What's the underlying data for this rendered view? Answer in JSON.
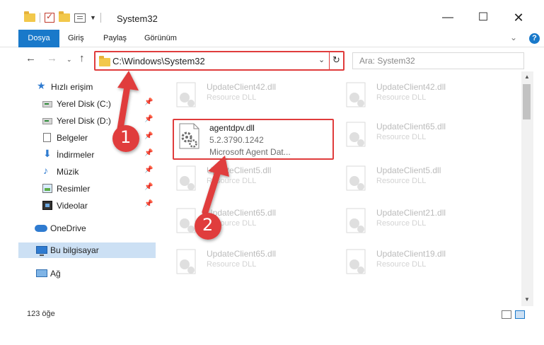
{
  "window": {
    "title": "System32",
    "minimize_icon": "minimize-icon",
    "maximize_icon": "maximize-icon",
    "close_icon": "close-icon"
  },
  "ribbon": {
    "tabs": [
      {
        "label": "Dosya",
        "active": true
      },
      {
        "label": "Giriş"
      },
      {
        "label": "Paylaş"
      },
      {
        "label": "Görünüm"
      }
    ],
    "accent": "#1979ca"
  },
  "nav": {
    "address": "C:\\Windows\\System32",
    "search_placeholder": "Ara: System32"
  },
  "sidebar": {
    "items": [
      {
        "label": "Hızlı erişim",
        "icon": "star-icon"
      },
      {
        "label": "Yerel Disk (C:)",
        "icon": "drive-icon",
        "pinned": true
      },
      {
        "label": "Yerel Disk (D:)",
        "icon": "drive-icon",
        "pinned": true
      },
      {
        "label": "Belgeler",
        "icon": "documents-icon",
        "pinned": true
      },
      {
        "label": "İndirmeler",
        "icon": "download-icon",
        "pinned": true
      },
      {
        "label": "Müzik",
        "icon": "music-icon",
        "pinned": true
      },
      {
        "label": "Resimler",
        "icon": "pictures-icon",
        "pinned": true
      },
      {
        "label": "Videolar",
        "icon": "videos-icon",
        "pinned": true
      },
      {
        "label": "OneDrive",
        "icon": "cloud-icon"
      },
      {
        "label": "Bu bilgisayar",
        "icon": "computer-icon",
        "selected": true
      },
      {
        "label": "Ağ",
        "icon": "network-icon"
      }
    ]
  },
  "files": {
    "highlighted": {
      "name": "agentdpv.dll",
      "version": "5.2.3790.1242",
      "description": "Microsoft Agent Dat..."
    },
    "background": [
      {
        "name": "UpdateClient42.dll",
        "type": "Resource DLL"
      },
      {
        "name": "UpdateClient42.dll",
        "type": "Resource DLL"
      },
      {
        "name": "UpdateClient65.dll",
        "type": "Resource DLL"
      },
      {
        "name": "UpdateClient5.dll",
        "type": "Resource DLL"
      },
      {
        "name": "UpdateClient5.dll",
        "type": "Resource DLL"
      },
      {
        "name": "UpdateClient65.dll",
        "type": "Resource DLL"
      },
      {
        "name": "UpdateClient21.dll",
        "type": "Resource DLL"
      },
      {
        "name": "UpdateClient65.dll",
        "type": "Resource DLL"
      },
      {
        "name": "UpdateClient19.dll",
        "type": "Resource DLL"
      }
    ]
  },
  "status": {
    "item_count": "123 öğe"
  },
  "annotations": {
    "step1": "1",
    "step2": "2",
    "color": "#e03c3c"
  }
}
